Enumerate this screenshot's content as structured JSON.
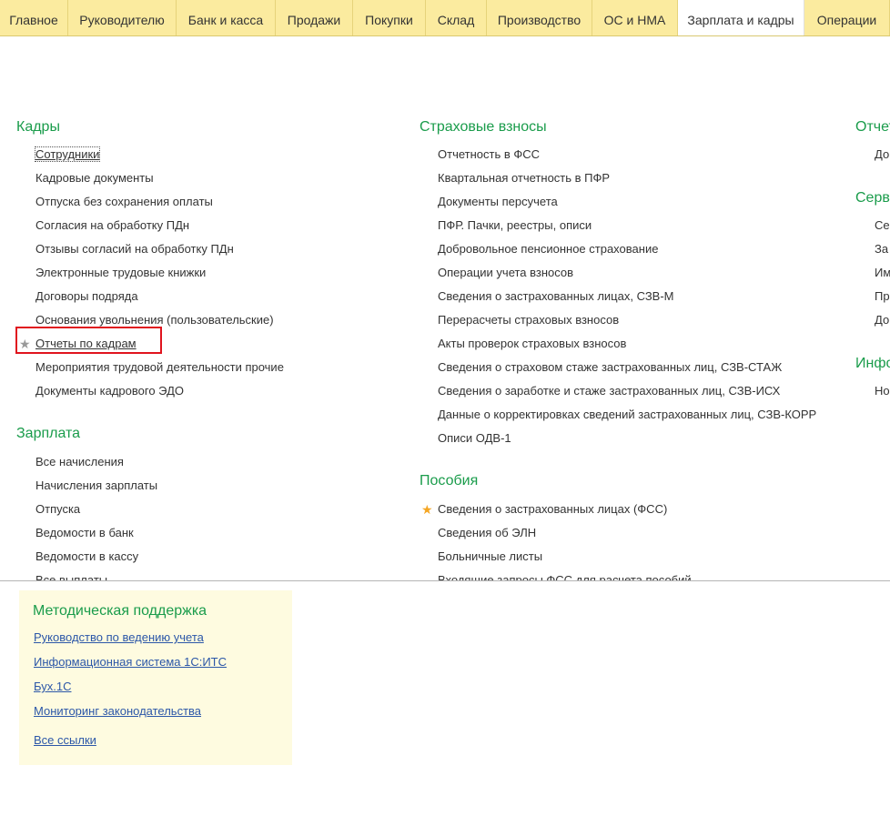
{
  "tabs": [
    {
      "label": "Главное",
      "active": false
    },
    {
      "label": "Руководителю",
      "active": false
    },
    {
      "label": "Банк и касса",
      "active": false
    },
    {
      "label": "Продажи",
      "active": false
    },
    {
      "label": "Покупки",
      "active": false
    },
    {
      "label": "Склад",
      "active": false
    },
    {
      "label": "Производство",
      "active": false
    },
    {
      "label": "ОС и НМА",
      "active": false
    },
    {
      "label": "Зарплата и кадры",
      "active": true
    },
    {
      "label": "Операции",
      "active": false
    }
  ],
  "columns": {
    "left": {
      "kadry": {
        "title": "Кадры",
        "items": [
          "Сотрудники",
          "Кадровые документы",
          "Отпуска без сохранения оплаты",
          "Согласия на обработку ПДн",
          "Отзывы согласий на обработку ПДн",
          "Электронные трудовые книжки",
          "Договоры подряда",
          "Основания увольнения (пользовательские)",
          "Отчеты по кадрам",
          "Мероприятия трудовой деятельности прочие",
          "Документы кадрового ЭДО"
        ]
      },
      "zarplata": {
        "title": "Зарплата",
        "items": [
          "Все начисления",
          "Начисления зарплаты",
          "Отпуска",
          "Ведомости в банк",
          "Ведомости в кассу",
          "Все выплаты"
        ]
      }
    },
    "middle": {
      "vznosy": {
        "title": "Страховые взносы",
        "items": [
          "Отчетность в ФСС",
          "Квартальная отчетность в ПФР",
          "Документы персучета",
          "ПФР. Пачки, реестры, описи",
          "Добровольное пенсионное страхование",
          "Операции учета взносов",
          "Сведения о застрахованных лицах, СЗВ-М",
          "Перерасчеты страховых взносов",
          "Акты проверок страховых взносов",
          "Сведения о страховом стаже застрахованных лиц, СЗВ-СТАЖ",
          "Сведения о заработке и стаже застрахованных лиц, СЗВ-ИСХ",
          "Данные о корректировках сведений застрахованных лиц, СЗВ-КОРР",
          "Описи ОДВ-1"
        ]
      },
      "posobiya": {
        "title": "Пособия",
        "items": [
          "Сведения о застрахованных лицах (ФСС)",
          "Сведения об ЭЛН",
          "Больничные листы",
          "Входящие запросы ФСС для расчета пособий"
        ]
      }
    },
    "right": {
      "group1": {
        "title": "Отчет",
        "items": [
          "До"
        ]
      },
      "group2": {
        "title": "Серв",
        "items": [
          "Се",
          "За",
          "Им",
          "Пр",
          "До"
        ]
      },
      "group3": {
        "title": "Инфо",
        "items": [
          "Но"
        ]
      }
    }
  },
  "support": {
    "title": "Методическая поддержка",
    "links": [
      "Руководство по ведению учета",
      "Информационная система 1С:ИТС",
      "Бух.1С",
      "Мониторинг законодательства",
      "Все ссылки"
    ]
  },
  "colors": {
    "nav_bg": "#fbeb9f",
    "group_title": "#1a9c4b",
    "link": "#2c57a8",
    "highlight": "#e0141e",
    "star_favorite": "#f5a623"
  }
}
